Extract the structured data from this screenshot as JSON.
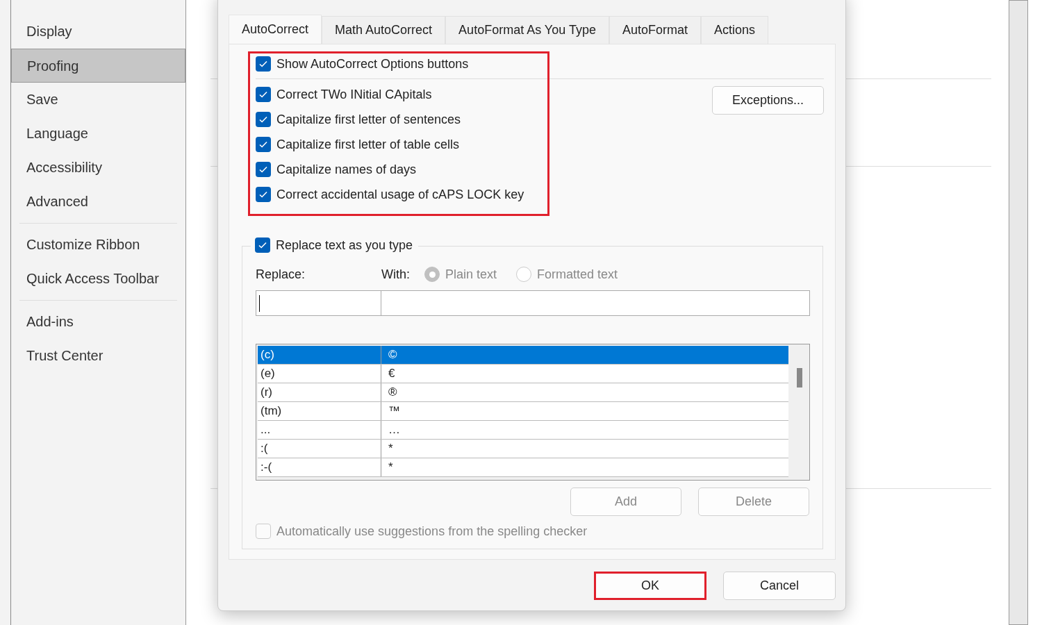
{
  "sidebar": {
    "groups": [
      {
        "items": [
          {
            "label": "Display",
            "selected": false
          },
          {
            "label": "Proofing",
            "selected": true
          },
          {
            "label": "Save",
            "selected": false
          },
          {
            "label": "Language",
            "selected": false
          },
          {
            "label": "Accessibility",
            "selected": false
          },
          {
            "label": "Advanced",
            "selected": false
          }
        ]
      },
      {
        "items": [
          {
            "label": "Customize Ribbon",
            "selected": false
          },
          {
            "label": "Quick Access Toolbar",
            "selected": false
          }
        ]
      },
      {
        "items": [
          {
            "label": "Add-ins",
            "selected": false
          },
          {
            "label": "Trust Center",
            "selected": false
          }
        ]
      }
    ]
  },
  "dialog": {
    "tabs": [
      {
        "label": "AutoCorrect",
        "selected": true
      },
      {
        "label": "Math AutoCorrect",
        "selected": false
      },
      {
        "label": "AutoFormat As You Type",
        "selected": false
      },
      {
        "label": "AutoFormat",
        "selected": false
      },
      {
        "label": "Actions",
        "selected": false
      }
    ],
    "options_highlighted": true,
    "top_option": {
      "label": "Show AutoCorrect Options buttons",
      "checked": true
    },
    "options": [
      {
        "label": "Correct TWo INitial CApitals",
        "checked": true
      },
      {
        "label": "Capitalize first letter of sentences",
        "checked": true
      },
      {
        "label": "Capitalize first letter of table cells",
        "checked": true
      },
      {
        "label": "Capitalize names of days",
        "checked": true
      },
      {
        "label": "Correct accidental usage of cAPS LOCK key",
        "checked": true
      }
    ],
    "exceptions_button": "Exceptions...",
    "replace_section": {
      "toggle": {
        "label": "Replace text as you type",
        "checked": true
      },
      "replace_label": "Replace:",
      "with_label": "With:",
      "format_disabled": true,
      "format_options": [
        {
          "label": "Plain text",
          "selected": true
        },
        {
          "label": "Formatted text",
          "selected": false
        }
      ],
      "entries": [
        {
          "replace": "(c)",
          "with": "©",
          "selected": true
        },
        {
          "replace": "(e)",
          "with": "€",
          "selected": false
        },
        {
          "replace": "(r)",
          "with": "®",
          "selected": false
        },
        {
          "replace": "(tm)",
          "with": "™",
          "selected": false
        },
        {
          "replace": "...",
          "with": "…",
          "selected": false
        },
        {
          "replace": ":(",
          "with": "*",
          "selected": false
        },
        {
          "replace": ":-(",
          "with": "*",
          "selected": false
        }
      ],
      "buttons": [
        {
          "label": "Add",
          "disabled": true
        },
        {
          "label": "Delete",
          "disabled": true
        }
      ],
      "suggestions_option": {
        "label": "Automatically use suggestions from the spelling checker",
        "checked": false,
        "disabled": true
      }
    },
    "footer_buttons": [
      {
        "label": "OK",
        "highlighted": true
      },
      {
        "label": "Cancel",
        "highlighted": false
      }
    ]
  }
}
